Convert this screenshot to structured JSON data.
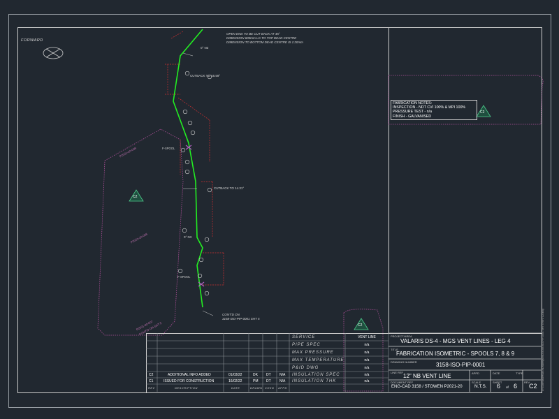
{
  "drawing": {
    "forward_label": "FORWARD",
    "top_note_line1": "OPEN END TO BE CUT BACK AT 45°",
    "top_note_line2": "DIMENSION 600mm LG TO TOP DEAD CENTRE",
    "top_note_line3": "DIMENSION TO BOTTOM DEAD CENTRE IS 1:20mm",
    "cutback_1": "CUTBACK TO 16.59°",
    "cutback_2": "CUTBACK TO 14.31°",
    "elbow_1": "0° N3",
    "elbow_2": "0° N3",
    "cont_on_line1": "CONT'D ON",
    "cont_on_line2": "3158-ISO-PIP-0001 SHT 5",
    "spool_tag_1": "F-SPOOL",
    "spool_tag_2": "F-SPOOL",
    "cloud_label_1": "P2021-20-009",
    "cloud_label_2": "P2021-20-008",
    "cloud_label_3": "P2021-20-007",
    "cloud_label_3b": "CONT'D ON SHT 5",
    "revision_triangle_left": "C2",
    "revision_triangle_notes": "C2",
    "revision_triangle_table": "C2",
    "side_text": "U:\\3158\\Valaris\\DS4\\Drawings\\ISO\\3158-ISO-PIP-0001 SHT 6 REV C2.dwg"
  },
  "fabrication_notes": {
    "title": "FABRICATION NOTES:",
    "line1": "INSPECTION - NDT CVI 100% & MPI 100%",
    "line2": "PRESSURE TEST - n/a",
    "line3": "FINISH - GALVANISED"
  },
  "service_table": {
    "header_value": "VENT LINE",
    "rows": [
      {
        "label": "SERVICE",
        "value": ""
      },
      {
        "label": "PIPE SPEC",
        "value": "n/a"
      },
      {
        "label": "MAX PRESSURE",
        "value": "n/a"
      },
      {
        "label": "MAX TEMPERATURE",
        "value": "n/a"
      },
      {
        "label": "P&ID DWG",
        "value": "n/a"
      },
      {
        "label": "INSULATION SPEC",
        "value": "n/a"
      },
      {
        "label": "INSULATION THK",
        "value": "n/a"
      }
    ]
  },
  "revisions": {
    "rows": [
      {
        "rev": "C2",
        "description": "ADDITIONAL INFO ADDED",
        "date": "01/03/22",
        "drawn": "DK",
        "chkd": "DT",
        "appd": "N/A"
      },
      {
        "rev": "C1",
        "description": "ISSUED FOR CONSTRUCTION",
        "date": "16/02/22",
        "drawn": "PM",
        "chkd": "DT",
        "appd": "N/A"
      }
    ],
    "headers": {
      "rev": "REV",
      "description": "DESCRIPTION",
      "date": "DATE",
      "drawn": "DRAWN",
      "chkd": "CHKD",
      "appd": "APPD"
    }
  },
  "title_block": {
    "project_label": "PROJECT/AREA",
    "project": "VALARIS DS-4 - MGS VENT LINES - LEG 4",
    "title_label": "TITLE",
    "title": "FABRICATION ISOMETRIC - SPOOLS 7, 8 & 9",
    "drawing_no_label": "DRAWING NUMBER",
    "drawing_no": "3158-ISO-PIP-0001",
    "line_ref_label": "LINE REF",
    "line_ref": "12\" NB VENT LINE",
    "doc_ref_label": "DOCUMENT REF",
    "doc_ref": "ENG-CAD 3158 / STOWEN P2021-20",
    "scale_label": "SCALE",
    "scale": "N.T.S.",
    "sheet_label": "SHEET",
    "sheet": "6",
    "of": "of",
    "sheets": "6",
    "rev_label": "REV",
    "rev": "C2",
    "appd_label": "APPD",
    "date_label": "DATE",
    "type_label": "TYPE"
  }
}
